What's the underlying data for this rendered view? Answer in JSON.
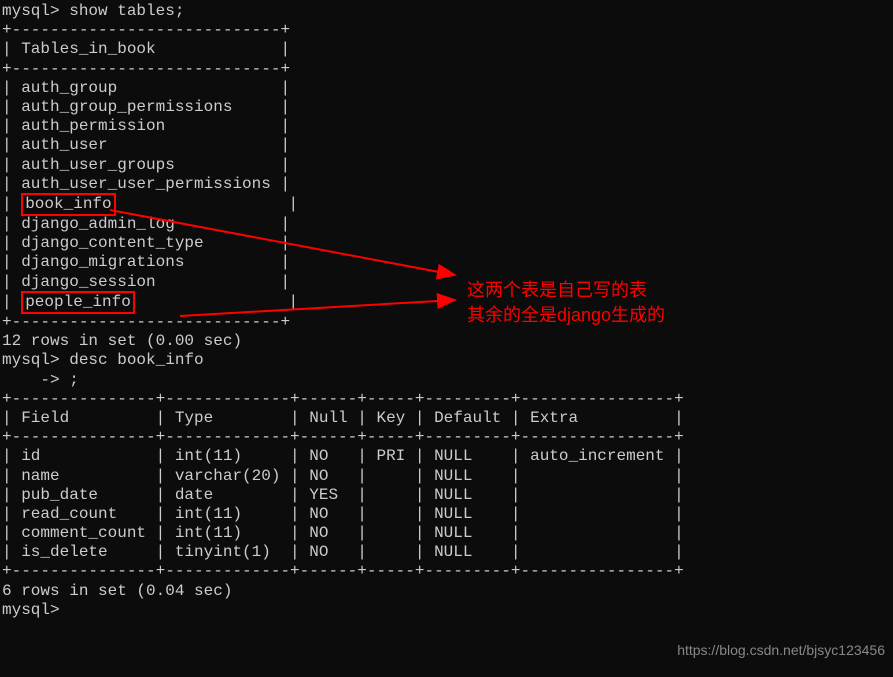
{
  "prompt1": "mysql> show tables;",
  "tables_header_sep": "+----------------------------+",
  "tables_header": "| Tables_in_book             |",
  "tables": [
    "| auth_group                 |",
    "| auth_group_permissions     |",
    "| auth_permission            |",
    "| auth_user                  |",
    "| auth_user_groups           |",
    "| auth_user_user_permissions |"
  ],
  "book_info_prefix": "| ",
  "book_info": "book_info",
  "book_info_suffix": "                  |",
  "tables2": [
    "| django_admin_log           |",
    "| django_content_type        |",
    "| django_migrations          |",
    "| django_session             |"
  ],
  "people_info_prefix": "| ",
  "people_info": "people_info",
  "people_info_suffix": "                |",
  "rows_result1": "12 rows in set (0.00 sec)",
  "blank": "",
  "prompt2": "mysql> desc book_info",
  "prompt2_cont": "    -> ;",
  "desc_sep": "+---------------+-------------+------+-----+---------+----------------+",
  "desc_header": "| Field         | Type        | Null | Key | Default | Extra          |",
  "desc_rows": [
    "| id            | int(11)     | NO   | PRI | NULL    | auto_increment |",
    "| name          | varchar(20) | NO   |     | NULL    |                |",
    "| pub_date      | date        | YES  |     | NULL    |                |",
    "| read_count    | int(11)     | NO   |     | NULL    |                |",
    "| comment_count | int(11)     | NO   |     | NULL    |                |",
    "| is_delete     | tinyint(1)  | NO   |     | NULL    |                |"
  ],
  "rows_result2": "6 rows in set (0.04 sec)",
  "prompt3": "mysql>",
  "annotation_line1": "这两个表是自己写的表",
  "annotation_line2": "其余的全是django生成的",
  "watermark": "https://blog.csdn.net/bjsyc123456"
}
